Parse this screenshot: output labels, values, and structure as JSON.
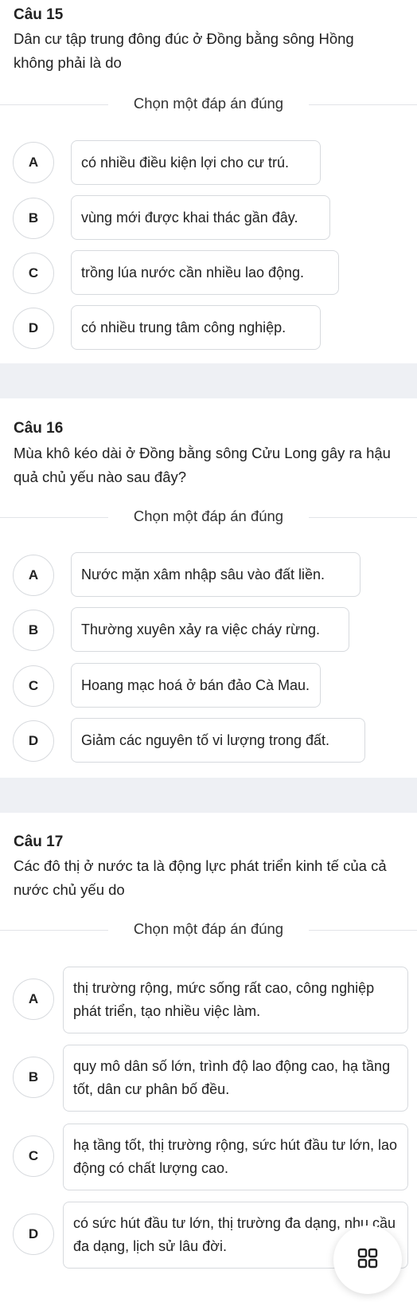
{
  "instruction": "Chọn một đáp án đúng",
  "questions": [
    {
      "number": "Câu 15",
      "text": "Dân cư tập trung đông đúc ở Đồng bằng sông Hồng không phải là do",
      "options": [
        {
          "letter": "A",
          "text": "có nhiều điều kiện lợi cho cư trú."
        },
        {
          "letter": "B",
          "text": "vùng mới được khai thác gần đây."
        },
        {
          "letter": "C",
          "text": "trồng lúa nước cần nhiều lao động."
        },
        {
          "letter": "D",
          "text": "có nhiều trung tâm công nghiệp."
        }
      ]
    },
    {
      "number": "Câu 16",
      "text": "Mùa khô kéo dài ở Đồng bằng sông Cửu Long gây ra hậu quả chủ yếu nào sau đây?",
      "options": [
        {
          "letter": "A",
          "text": "Nước mặn xâm nhập sâu vào đất liền."
        },
        {
          "letter": "B",
          "text": "Thường xuyên xảy ra việc cháy rừng."
        },
        {
          "letter": "C",
          "text": "Hoang mạc hoá ở bán đảo Cà Mau."
        },
        {
          "letter": "D",
          "text": "Giảm các nguyên tố vi lượng trong đất."
        }
      ]
    },
    {
      "number": "Câu 17",
      "text": "Các đô thị ở nước ta là động lực phát triển kinh tế của cả nước chủ yếu do",
      "options": [
        {
          "letter": "A",
          "text": "thị trường rộng, mức sống rất cao, công nghiệp phát triển, tạo nhiều việc làm."
        },
        {
          "letter": "B",
          "text": "quy mô dân số lớn, trình độ lao động cao, hạ tầng tốt, dân cư phân bố đều."
        },
        {
          "letter": "C",
          "text": "hạ tầng tốt, thị trường rộng, sức hút đầu tư lớn, lao động có chất lượng cao."
        },
        {
          "letter": "D",
          "text": "có sức hút đầu tư lớn, thị trường đa dạng, nhu cầu đa dạng, lịch sử lâu đời."
        }
      ]
    }
  ],
  "grid_button_icon": "grid-icon"
}
